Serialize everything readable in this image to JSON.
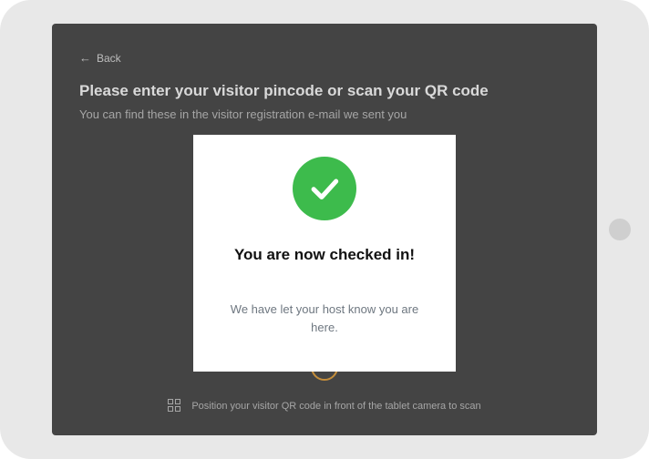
{
  "back": {
    "label": "Back"
  },
  "page": {
    "title": "Please enter your visitor pincode or scan your QR code",
    "subtitle": "You can find these in the visitor registration e-mail we sent you"
  },
  "qrHint": {
    "text": "Position your visitor QR code in front of the tablet camera to scan"
  },
  "modal": {
    "title": "You are now checked in!",
    "message": "We have let your host know you are here."
  }
}
